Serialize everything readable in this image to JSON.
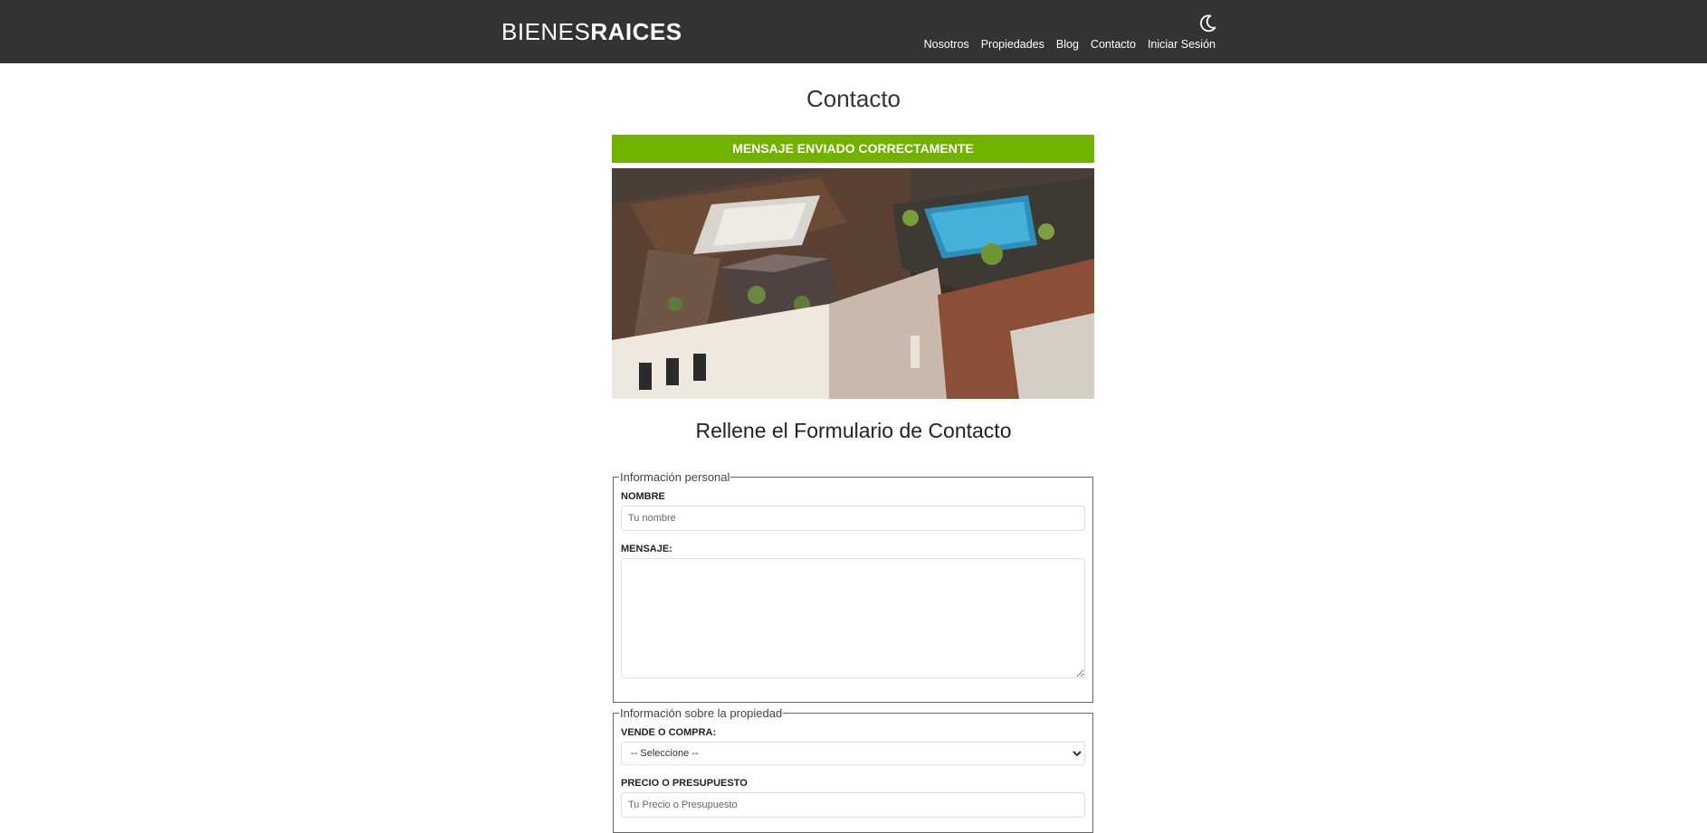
{
  "header": {
    "logo_light": "BIENES",
    "logo_bold": "RAICES",
    "nav": [
      "Nosotros",
      "Propiedades",
      "Blog",
      "Contacto",
      "Iniciar Sesión"
    ],
    "dark_mode_icon": "moon-icon"
  },
  "main": {
    "title": "Contacto",
    "alert": "MENSAJE ENVIADO CORRECTAMENTE",
    "form_title": "Rellene el Formulario de Contacto"
  },
  "form": {
    "personal_legend": "Información personal",
    "name_label": "NOMBRE",
    "name_placeholder": "Tu nombre",
    "message_label": "MENSAJE:",
    "property_legend": "Información sobre la propiedad",
    "type_label": "VENDE O COMPRA:",
    "type_selected": "-- Seleccione --",
    "price_label": "PRECIO O PRESUPUESTO",
    "price_placeholder": "Tu Precio o Presupuesto"
  },
  "colors": {
    "header_bg": "#333333",
    "alert_bg": "#71b100"
  }
}
